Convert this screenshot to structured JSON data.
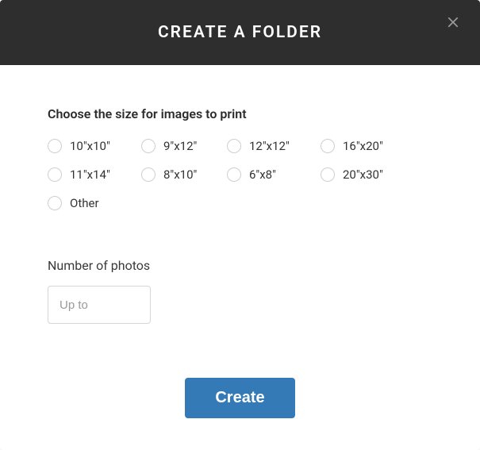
{
  "header": {
    "title": "CREATE A FOLDER"
  },
  "size_section": {
    "label": "Choose the size for images to print",
    "options": [
      {
        "label": "10\"x10\""
      },
      {
        "label": "9\"x12\""
      },
      {
        "label": "12\"x12\""
      },
      {
        "label": "16\"x20\""
      },
      {
        "label": "11\"x14\""
      },
      {
        "label": "8\"x10\""
      },
      {
        "label": "6\"x8\""
      },
      {
        "label": "20\"x30\""
      },
      {
        "label": "Other"
      }
    ]
  },
  "photo_count": {
    "label": "Number of photos",
    "placeholder": "Up to",
    "value": ""
  },
  "footer": {
    "create_label": "Create"
  }
}
